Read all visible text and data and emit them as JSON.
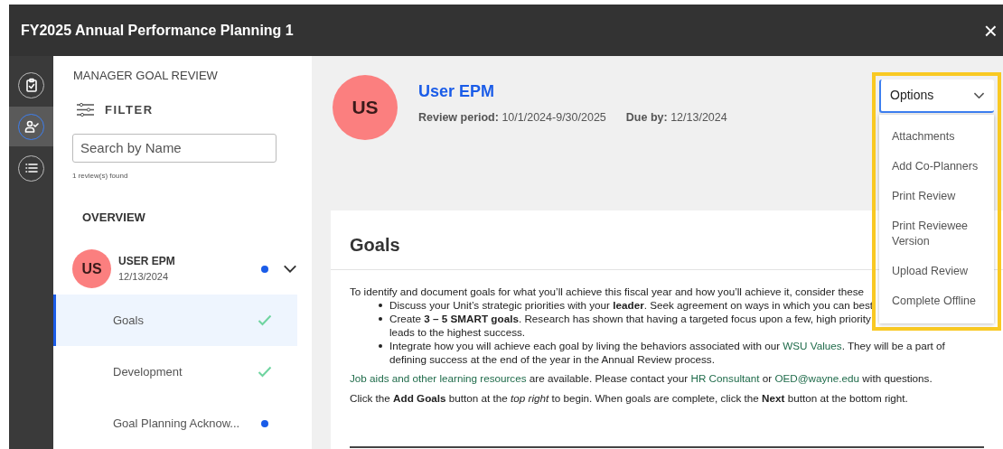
{
  "window": {
    "title": "FY2025 Annual Performance Planning 1",
    "close": "×"
  },
  "rail": [
    {
      "kind": "clipboard",
      "selected": false
    },
    {
      "kind": "user-check",
      "selected": true
    },
    {
      "kind": "list",
      "selected": false
    }
  ],
  "sidebar": {
    "heading": "MANAGER GOAL REVIEW",
    "filter": "FILTER",
    "search": {
      "placeholder": "Search by Name"
    },
    "found": "1 review(s) found",
    "overview": "OVERVIEW",
    "reviewee": {
      "initials": "US",
      "name": "USER EPM",
      "date": "12/13/2024",
      "unread": true,
      "expanded": true
    },
    "items": [
      {
        "label": "Goals",
        "selected": true,
        "kind": "check"
      },
      {
        "label": "Development",
        "selected": false,
        "kind": "check"
      },
      {
        "label": "Goal Planning Acknow...",
        "selected": false,
        "kind": "dot"
      }
    ]
  },
  "header": {
    "initials": "US",
    "name": "User EPM",
    "period_label": "Review period:",
    "period": "10/1/2024-9/30/2025",
    "due_label": "Due by:",
    "due": "12/13/2024"
  },
  "options": {
    "label": "Options",
    "expanded": true,
    "highlighted": true,
    "items": [
      "Attachments",
      "Add Co-Planners",
      "Print Review",
      "Print Reviewee Version",
      "Upload Review",
      "Complete Offline"
    ]
  },
  "goals": {
    "title": "Goals",
    "intro": "To identify and document goals for what you’ll achieve this fiscal year and how you’ll achieve it, consider these",
    "bullets": [
      [
        {
          "text": "Discuss your Unit’s strategic priorities with your **leader**. Seek agreement on ways in which you can best"
        }
      ],
      [
        {
          "text": "Create **3 – 5 SMART goals**. Research has shown that having a targeted focus upon a few, high priority"
        },
        {
          "text": "leads to the highest success.",
          "break_before": true
        }
      ],
      [
        {
          "text": "Integrate how you will achieve each goal by living the behaviors associated with our "
        },
        {
          "text": "WSU Values",
          "link": true
        },
        {
          "text": ". They will be a part of defining success at the end of the year in the Annual Review process."
        }
      ]
    ],
    "resources": [
      {
        "text": "Job aids and other learning resources",
        "link": true
      },
      {
        "text": " are available. Please contact your "
      },
      {
        "text": "HR Consultant",
        "link": true
      },
      {
        "text": " or "
      },
      {
        "text": "OED@wayne.edu",
        "link": true
      },
      {
        "text": " with questions."
      }
    ],
    "instructions": "Click the **Add Goals** button at the *top right* to begin. When goals are complete, click the **Next** button at the bottom right."
  }
}
